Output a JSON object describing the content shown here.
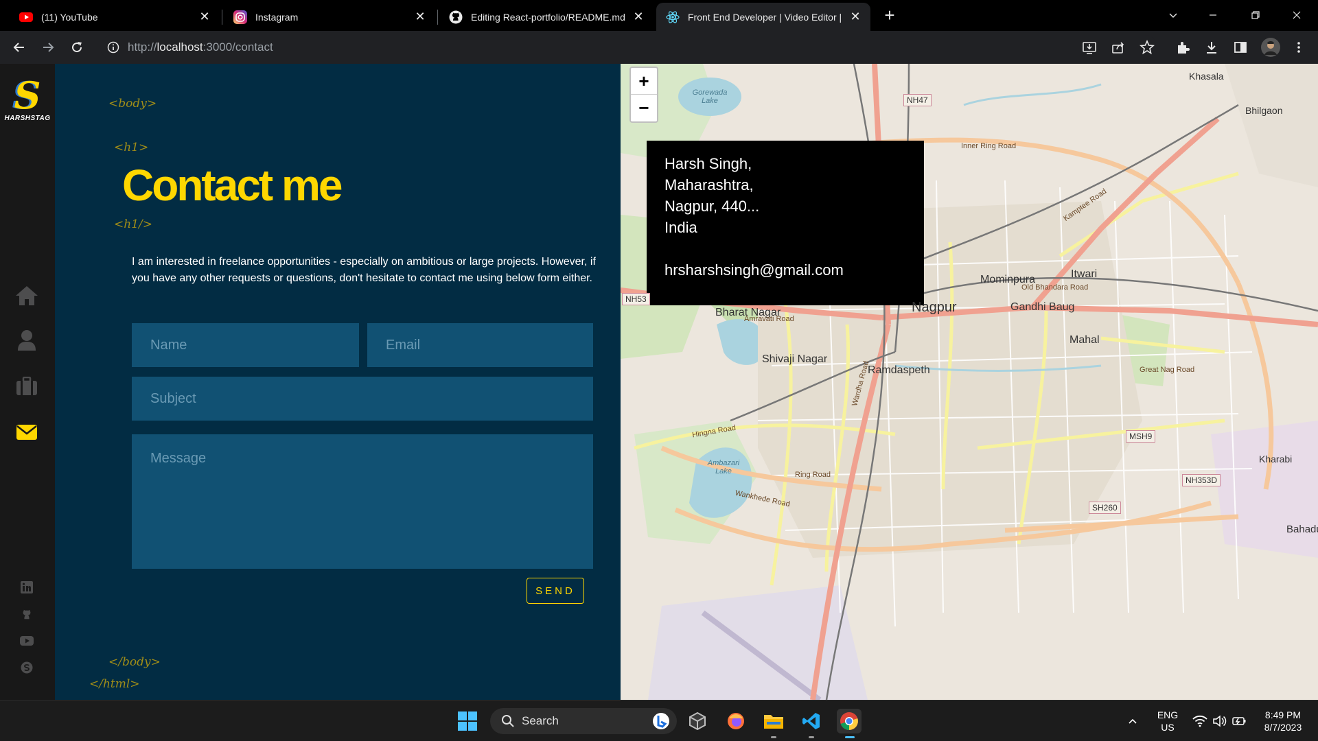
{
  "browser": {
    "tabs": [
      {
        "title": "(11) YouTube",
        "icon": "youtube-icon"
      },
      {
        "title": "Instagram",
        "icon": "instagram-icon"
      },
      {
        "title": "Editing React-portfolio/README.md",
        "icon": "github-icon"
      },
      {
        "title": "Front End Developer | Video Editor |",
        "icon": "react-icon",
        "active": true
      }
    ],
    "url_prefix": "http://",
    "url_host": "localhost",
    "url_path": ":3000/contact"
  },
  "sidebar": {
    "logo_letter": "S",
    "logo_text": "HARSHSTAG",
    "nav": [
      "home-icon",
      "user-icon",
      "briefcase-icon",
      "envelope-icon"
    ],
    "social": [
      "linkedin-icon",
      "github-icon",
      "youtube-icon",
      "skype-icon"
    ]
  },
  "content": {
    "tag_body_open": "<body>",
    "tag_h1_open": "<h1>",
    "heading": "Contact me",
    "tag_h1_close": "<h1/>",
    "intro": "I am interested in freelance opportunities - especially on ambitious or large projects. However, if you have any other requests or questions, don't hesitate to contact me using below form either.",
    "form": {
      "name_placeholder": "Name",
      "email_placeholder": "Email",
      "subject_placeholder": "Subject",
      "message_placeholder": "Message",
      "send_label": "SEND"
    },
    "tag_body_close": "</body>",
    "tag_html_close": "</html>"
  },
  "map": {
    "zoom_in": "+",
    "zoom_out": "−",
    "popup": {
      "line1": "Harsh Singh,",
      "line2": "Maharashtra,",
      "line3": "Nagpur, 440...",
      "line4": "India",
      "email": "hrsharshsingh@gmail.com"
    },
    "places": {
      "nagpur": "Nagpur",
      "bharat_nagar": "Bharat Nagar",
      "shivaji_nagar": "Shivaji Nagar",
      "ramdaspeth": "Ramdaspeth",
      "mominpura": "Mominpura",
      "itwari": "Itwari",
      "gandhi_baug": "Gandhi Baug",
      "mahal": "Mahal",
      "khasala": "Khasala",
      "bhilgaon": "Bhilgaon",
      "kharabi": "Kharabi",
      "bahadu": "Bahadu",
      "gorewada": "Gorewada Lake",
      "ambazari": "Ambazari Lake"
    },
    "roads": {
      "inner_ring": "Inner Ring Road",
      "kamptee": "Kamptee Road",
      "old_bhandara": "Old Bhandara Road",
      "amravati": "Amravati Road",
      "great_nag": "Great Nag Road",
      "ring_road": "Ring Road",
      "wardha": "Wardha Road",
      "hingna": "Hingna Road",
      "wankhede": "Wankhede Road"
    },
    "shields": {
      "nh47": "NH47",
      "nh53": "NH53",
      "msh9": "MSH9",
      "nh353d": "NH353D",
      "sh260": "SH260"
    }
  },
  "taskbar": {
    "search_label": "Search",
    "lang_line1": "ENG",
    "lang_line2": "US",
    "time": "8:49 PM",
    "date": "8/7/2023"
  }
}
